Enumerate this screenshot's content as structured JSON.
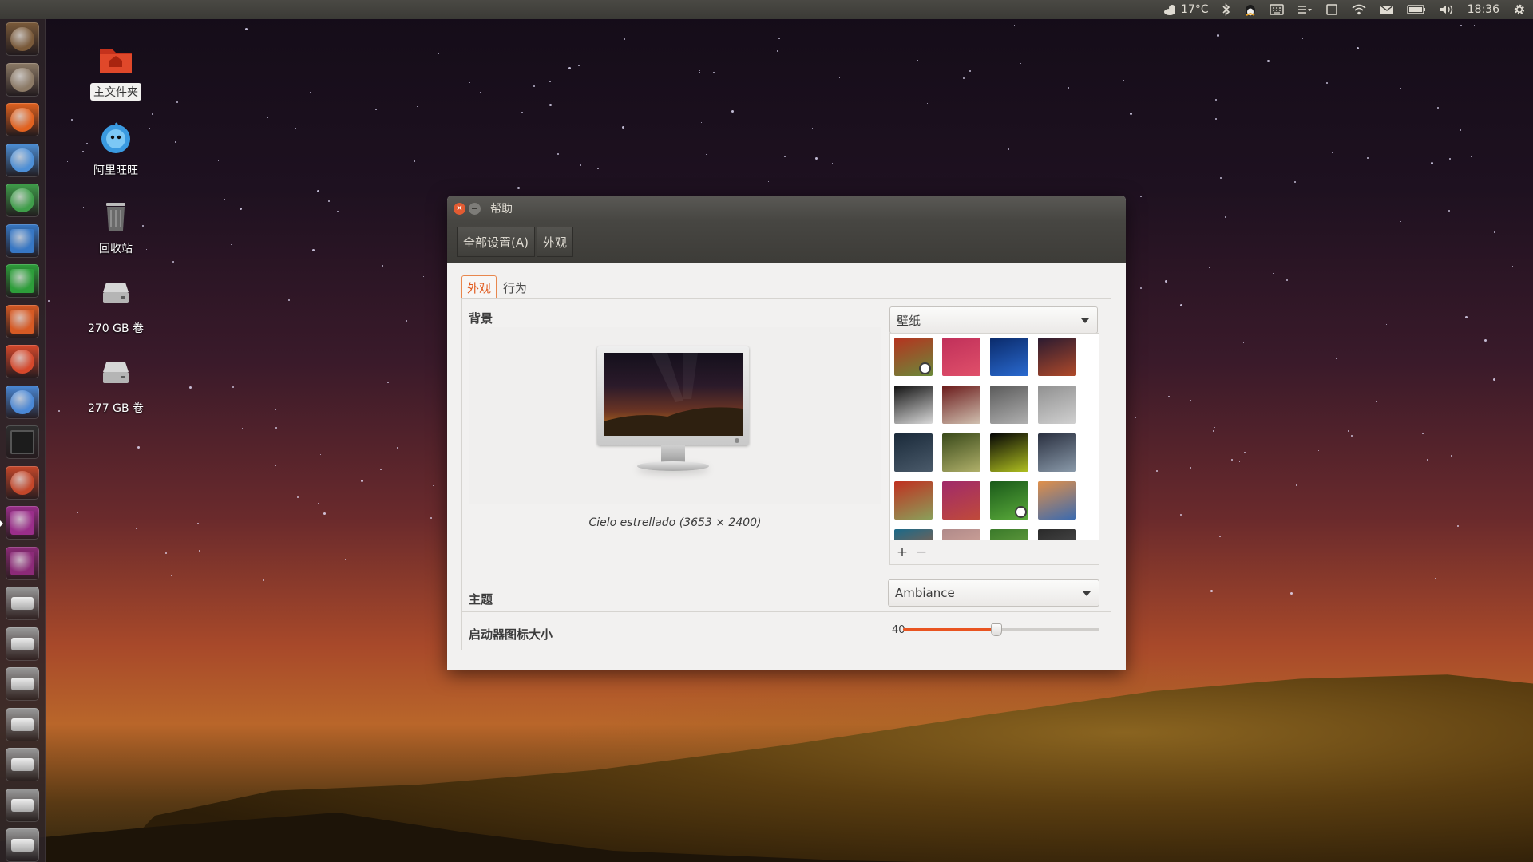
{
  "top_panel": {
    "weather": "17°C",
    "clock": "18:36"
  },
  "launcher": {
    "items": [
      {
        "name": "dash",
        "color": "#7a5a3a"
      },
      {
        "name": "files",
        "color": "#8c7a66"
      },
      {
        "name": "firefox",
        "color": "#e2621f"
      },
      {
        "name": "chromium",
        "color": "#4d8fd6"
      },
      {
        "name": "chrome",
        "color": "#3f9e4a"
      },
      {
        "name": "writer",
        "color": "#3777c4"
      },
      {
        "name": "calc",
        "color": "#2d9e3a"
      },
      {
        "name": "impress",
        "color": "#d75a24"
      },
      {
        "name": "software-center",
        "color": "#d6482b"
      },
      {
        "name": "software-updater",
        "color": "#4a88d6"
      },
      {
        "name": "terminal",
        "color": "#2e2e2e"
      },
      {
        "name": "system-settings",
        "color": "#c4472a"
      },
      {
        "name": "display",
        "color": "#9a2e8a"
      },
      {
        "name": "workspace",
        "color": "#8c2a78"
      },
      {
        "name": "drive-1",
        "color": "#9a9a9a"
      },
      {
        "name": "drive-2",
        "color": "#9a9a9a"
      },
      {
        "name": "drive-3",
        "color": "#9a9a9a"
      },
      {
        "name": "drive-4",
        "color": "#9a9a9a"
      },
      {
        "name": "drive-5",
        "color": "#9a9a9a"
      },
      {
        "name": "drive-6",
        "color": "#9a9a9a"
      },
      {
        "name": "drive-7",
        "color": "#9a9a9a"
      }
    ]
  },
  "desktop_icons": [
    {
      "label": "主文件夹",
      "icon": "home-folder-icon"
    },
    {
      "label": "阿里旺旺",
      "icon": "aliwangwang-icon"
    },
    {
      "label": "回收站",
      "icon": "trash-icon"
    },
    {
      "label": "270 GB 卷",
      "icon": "drive-icon"
    },
    {
      "label": "277 GB 卷",
      "icon": "drive-icon"
    }
  ],
  "window": {
    "title": "帮助",
    "breadcrumbs": [
      "全部设置(A)",
      "外观"
    ],
    "tabs": [
      "外观",
      "行为"
    ],
    "background_label": "背景",
    "wallpaper_combo": "壁纸",
    "wallpaper_caption": "Cielo estrellado (3653 × 2400)",
    "thumbnails": [
      {
        "colors": [
          "#b6321f",
          "#6a8a3a"
        ],
        "checked": true
      },
      {
        "colors": [
          "#c0305a",
          "#e0506a"
        ],
        "checked": false
      },
      {
        "colors": [
          "#0a2a6a",
          "#2a6ad0"
        ],
        "checked": false
      },
      {
        "colors": [
          "#2a1a30",
          "#b04a2a"
        ],
        "checked": false
      },
      {
        "colors": [
          "#111111",
          "#d8d8d8"
        ],
        "checked": false
      },
      {
        "colors": [
          "#6a1a1a",
          "#d0c0b0"
        ],
        "checked": false
      },
      {
        "colors": [
          "#5a5a5a",
          "#b0b0b0"
        ],
        "checked": false
      },
      {
        "colors": [
          "#909090",
          "#d0d0d0"
        ],
        "checked": false
      },
      {
        "colors": [
          "#1a2a3a",
          "#4a5a6a"
        ],
        "checked": false
      },
      {
        "colors": [
          "#3a4a1a",
          "#b0b06a"
        ],
        "checked": false
      },
      {
        "colors": [
          "#050505",
          "#b0c020"
        ],
        "checked": false
      },
      {
        "colors": [
          "#2a3040",
          "#8a9aaa"
        ],
        "checked": false
      },
      {
        "colors": [
          "#c03020",
          "#8aa05a"
        ],
        "checked": false
      },
      {
        "colors": [
          "#a02a6a",
          "#c04a3a"
        ],
        "checked": false
      },
      {
        "colors": [
          "#1a5a1a",
          "#5aaa3a"
        ],
        "checked": true
      },
      {
        "colors": [
          "#e0904a",
          "#3a6ab0"
        ],
        "checked": false
      },
      {
        "colors": [
          "#1a6a8a",
          "#c05a2a"
        ],
        "checked": false
      },
      {
        "colors": [
          "#b08a8a",
          "#e0b0a0"
        ],
        "checked": false
      },
      {
        "colors": [
          "#3a7a2a",
          "#7ab04a"
        ],
        "checked": false
      },
      {
        "colors": [
          "#2a2a2a",
          "#5a5a5a"
        ],
        "checked": false
      }
    ],
    "add_button": "+",
    "remove_button": "−",
    "theme_label": "主题",
    "theme_value": "Ambiance",
    "launcher_size_label": "启动器图标大小",
    "launcher_size_value": "40",
    "launcher_size_fraction": 0.47
  },
  "colors": {
    "accent": "#e95420",
    "panel": "#3c3b37"
  }
}
